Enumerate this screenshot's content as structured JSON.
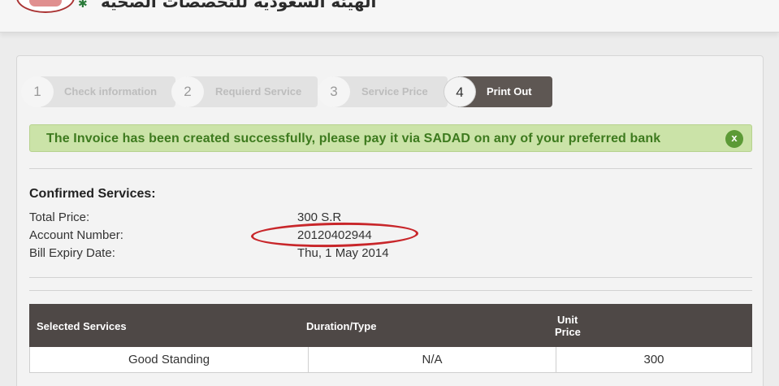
{
  "header": {
    "title": "الهيئة السعودية للتخصصات الصحية"
  },
  "wizard": {
    "steps": [
      {
        "number": "1",
        "label": "Check information"
      },
      {
        "number": "2",
        "label": "Requierd Service"
      },
      {
        "number": "3",
        "label": "Service Price"
      },
      {
        "number": "4",
        "label": "Print Out"
      }
    ],
    "active_step": 4
  },
  "alert": {
    "message": "The Invoice has been created successfully, please pay it via SADAD on any of your preferred bank",
    "close_glyph": "x"
  },
  "details": {
    "title": "Confirmed Services:",
    "rows": [
      {
        "label": "Total Price:",
        "value": "300 S.R"
      },
      {
        "label": "Account Number:",
        "value": "20120402944"
      },
      {
        "label": "Bill Expiry Date:",
        "value": "Thu, 1 May 2014"
      }
    ]
  },
  "table": {
    "headers": [
      "Selected Services",
      "Duration/Type",
      "Unit",
      "Price"
    ],
    "rows": [
      [
        "Good Standing",
        "N/A",
        "300"
      ]
    ]
  },
  "colors": {
    "alert_bg": "#cbe3a8",
    "alert_text": "#3d7a1e",
    "active_step": "#5e5753",
    "table_header": "#4e4846",
    "annotation": "#c8262a"
  }
}
